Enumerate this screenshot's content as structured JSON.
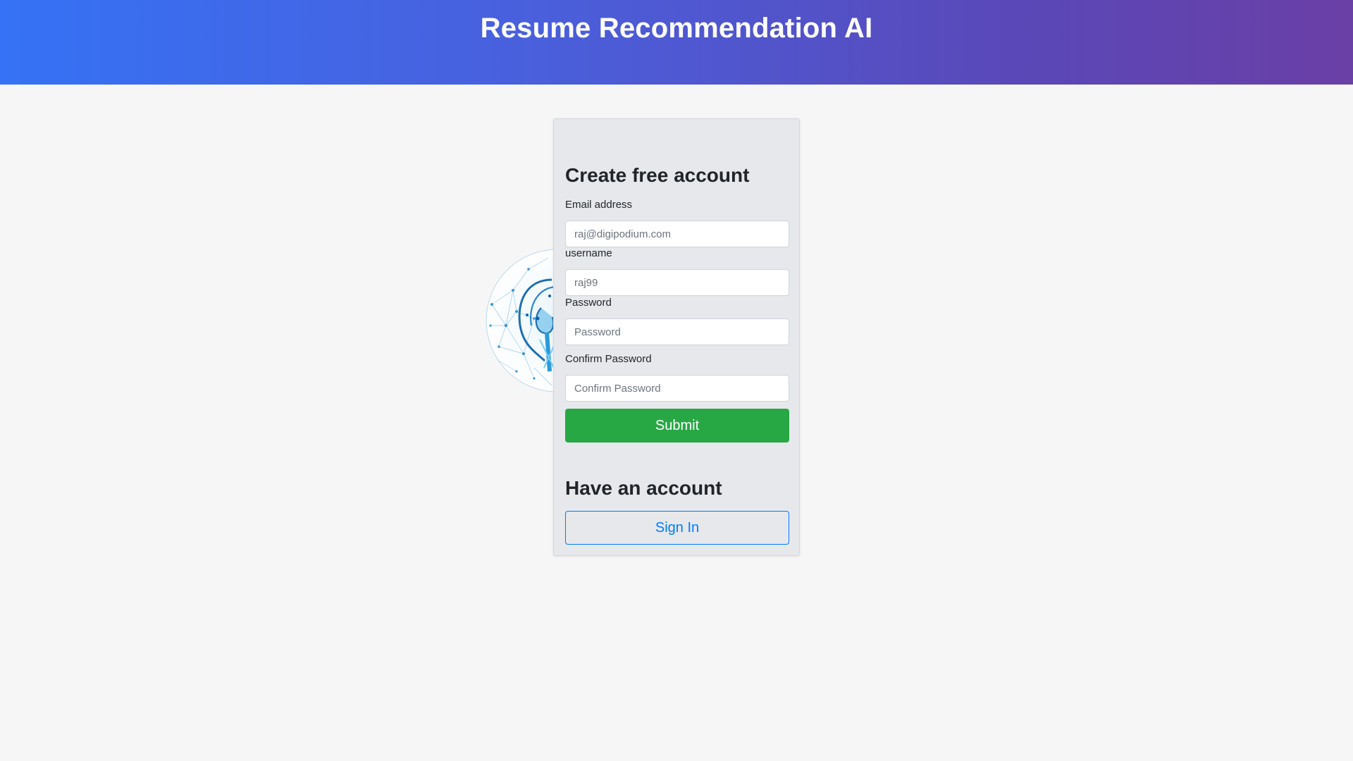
{
  "header": {
    "title": "Resume Recommendation AI"
  },
  "illustration": {
    "icon": "brain-network-globe-icon"
  },
  "signup": {
    "title": "Create free account",
    "email_label": "Email address",
    "email_placeholder": "raj@digipodium.com",
    "username_label": "username",
    "username_placeholder": "raj99",
    "password_label": "Password",
    "password_placeholder": "Password",
    "confirm_label": "Confirm Password",
    "confirm_placeholder": "Confirm Password",
    "submit_label": "Submit"
  },
  "signin": {
    "title": "Have an account",
    "button_label": "Sign In"
  },
  "colors": {
    "header_gradient_start": "#3572f5",
    "header_gradient_end": "#6a3fa6",
    "submit": "#28a745",
    "signin": "#007bff",
    "page_bg": "#f6f6f6"
  }
}
